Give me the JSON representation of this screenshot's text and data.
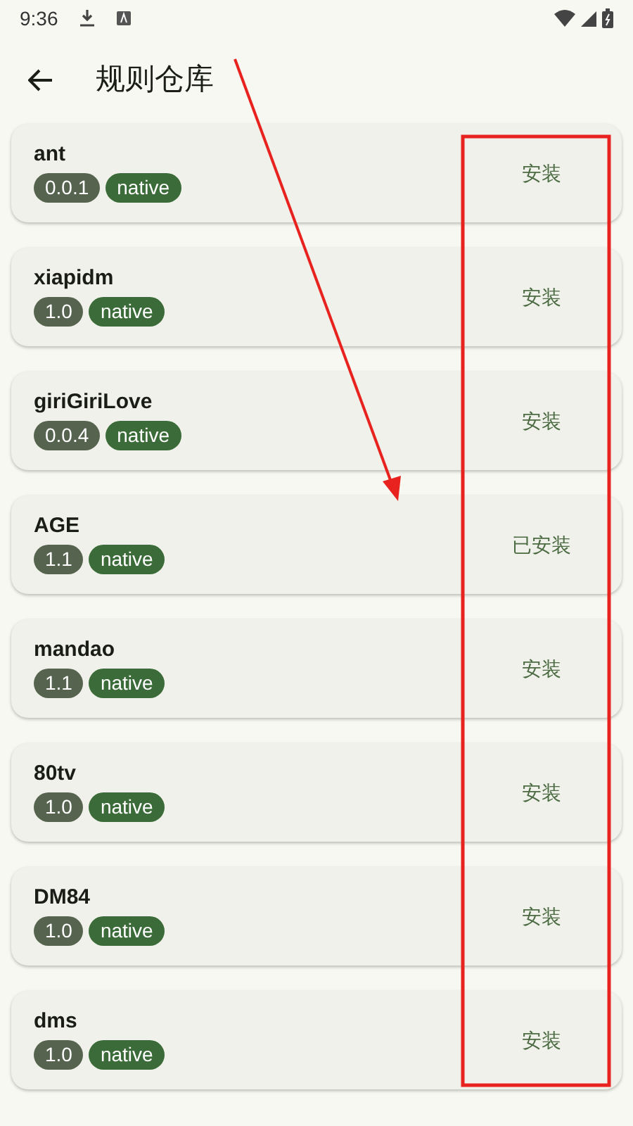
{
  "status_bar": {
    "time": "9:36"
  },
  "app_bar": {
    "title": "规则仓库"
  },
  "rules": [
    {
      "name": "ant",
      "version": "0.0.1",
      "tag": "native",
      "action": "安装"
    },
    {
      "name": "xiapidm",
      "version": "1.0",
      "tag": "native",
      "action": "安装"
    },
    {
      "name": "giriGiriLove",
      "version": "0.0.4",
      "tag": "native",
      "action": "安装"
    },
    {
      "name": "AGE",
      "version": "1.1",
      "tag": "native",
      "action": "已安装"
    },
    {
      "name": "mandao",
      "version": "1.1",
      "tag": "native",
      "action": "安装"
    },
    {
      "name": "80tv",
      "version": "1.0",
      "tag": "native",
      "action": "安装"
    },
    {
      "name": "DM84",
      "version": "1.0",
      "tag": "native",
      "action": "安装"
    },
    {
      "name": "dms",
      "version": "1.0",
      "tag": "native",
      "action": "安装"
    }
  ],
  "annotations": {
    "highlight_box": true,
    "arrow": true
  }
}
